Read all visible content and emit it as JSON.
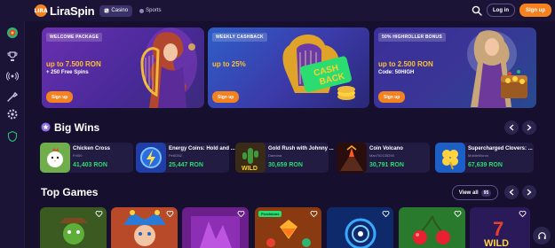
{
  "header": {
    "logo_badge": "LIRA",
    "logo_text": "LiraSpin",
    "nav": [
      {
        "label": "Casino",
        "active": true
      },
      {
        "label": "Sports",
        "active": false
      }
    ],
    "login_label": "Log in",
    "signup_label": "Sign up"
  },
  "sidebar": {
    "items": [
      {
        "icon": "casino-wheel-icon"
      },
      {
        "icon": "trophy-icon"
      },
      {
        "icon": "live-broadcast-icon"
      },
      {
        "icon": "tools-icon"
      },
      {
        "icon": "settings-gear-icon"
      },
      {
        "icon": "shield-icon"
      }
    ]
  },
  "banners": [
    {
      "tag": "WELCOME PACKAGE",
      "headline": "up to 7.500 RON",
      "subline": "+ 250 Free Spins",
      "cta": "Sign up"
    },
    {
      "tag": "WEEKLY CASHBACK",
      "headline": "up to 25%",
      "subline": "",
      "cta": "Sign up",
      "art_text_1": "CASH",
      "art_text_2": "BACK"
    },
    {
      "tag": "50% HIGHROLLER BONUS",
      "headline": "up to 2.500 RON",
      "subline": "Code: 50HIGH",
      "cta": "Sign up"
    }
  ],
  "big_wins": {
    "title": "Big Wins",
    "cards": [
      {
        "game": "Chicken Cross",
        "user": "Fr000",
        "amount": "41,403 RON"
      },
      {
        "game": "Energy Coins: Hold and ...",
        "user": "Pet0262",
        "amount": "25,447 RON"
      },
      {
        "game": "Gold Rush with Johnny ...",
        "user": "Damona",
        "amount": "30,659 RON",
        "thumb_text": "WILD"
      },
      {
        "game": "Coin Volcano",
        "user": "Man702135290",
        "amount": "30,791 RON"
      },
      {
        "game": "Supercharged Clovers: ...",
        "user": "MobileMoron",
        "amount": "67,639 RON"
      }
    ]
  },
  "top_games": {
    "title": "Top Games",
    "view_all_label": "View all",
    "view_all_count": "95",
    "tiles": [
      {
        "name": "Gold Rush western"
      },
      {
        "name": "Joker jester"
      },
      {
        "name": "Purple neon slot"
      },
      {
        "name": "Gems slot",
        "badge": "Provisions"
      },
      {
        "name": "Blue vortex slot"
      },
      {
        "name": "Cherries slot"
      },
      {
        "name": "Seven wild slot",
        "thumb_text": "WILD"
      }
    ]
  },
  "colors": {
    "accent_orange": "#f5821f",
    "win_green": "#2bdc71",
    "background": "#16102e",
    "panel": "#1b1436"
  }
}
